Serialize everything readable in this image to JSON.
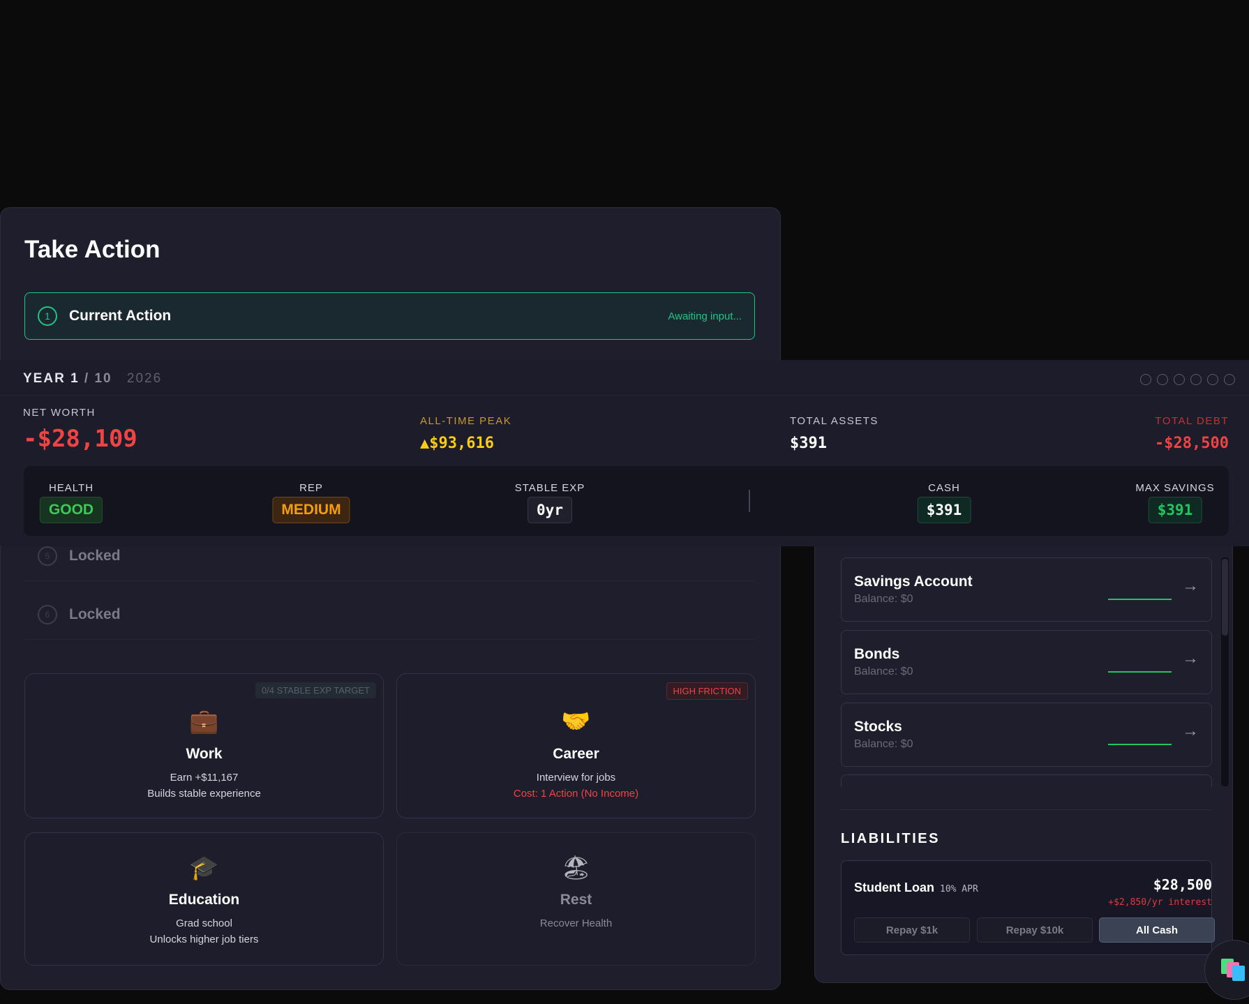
{
  "action_panel": {
    "title": "Take Action",
    "current_action": {
      "step": "1",
      "label": "Current Action",
      "status": "Awaiting input..."
    },
    "locked_steps": [
      {
        "step": "5",
        "label": "Locked"
      },
      {
        "step": "6",
        "label": "Locked"
      }
    ],
    "cards": [
      {
        "id": "work",
        "icon": "💼",
        "name": "Work",
        "line1": "Earn +$11,167",
        "line2": "Builds stable experience",
        "badge": "0/4 STABLE EXP TARGET"
      },
      {
        "id": "career",
        "icon": "🤝",
        "name": "Career",
        "line1": "Interview for jobs",
        "line2": "Cost: 1 Action (No Income)",
        "badge": "HIGH FRICTION"
      },
      {
        "id": "education",
        "icon": "🎓",
        "name": "Education",
        "line1": "Grad school",
        "line2": "Unlocks higher job tiers",
        "badge": ""
      },
      {
        "id": "rest",
        "icon": "🏖",
        "name": "Rest",
        "line1": "Recover Health",
        "line2": "",
        "badge": ""
      }
    ]
  },
  "status": {
    "year_label": "YEAR 1",
    "year_total": "/ 10",
    "calendar_year": "2026",
    "net_worth_label": "NET WORTH",
    "net_worth": "-$28,109",
    "peak_label": "ALL-TIME PEAK",
    "peak": "▲$93,616",
    "assets_label": "TOTAL ASSETS",
    "assets": "$391",
    "debt_label": "TOTAL DEBT",
    "debt": "-$28,500",
    "health_label": "HEALTH",
    "health": "GOOD",
    "rep_label": "REP",
    "rep": "MEDIUM",
    "exp_label": "STABLE EXP",
    "exp": "0yr",
    "cash_label": "CASH",
    "cash": "$391",
    "max_savings_label": "MAX SAVINGS",
    "max_savings": "$391"
  },
  "investments": [
    {
      "name": "Savings Account",
      "balance": "Balance: $0"
    },
    {
      "name": "Bonds",
      "balance": "Balance: $0"
    },
    {
      "name": "Stocks",
      "balance": "Balance: $0"
    }
  ],
  "liabilities": {
    "title": "LIABILITIES",
    "loan_name": "Student Loan",
    "apr": "10% APR",
    "amount": "$28,500",
    "interest": "+$2,850/yr interest",
    "buttons": [
      "Repay $1k",
      "Repay $10k",
      "All Cash"
    ]
  },
  "colors": {
    "accent_green": "#23c483",
    "danger_red": "#ef4444",
    "gold": "#facc15",
    "orange": "#f59e0b"
  }
}
